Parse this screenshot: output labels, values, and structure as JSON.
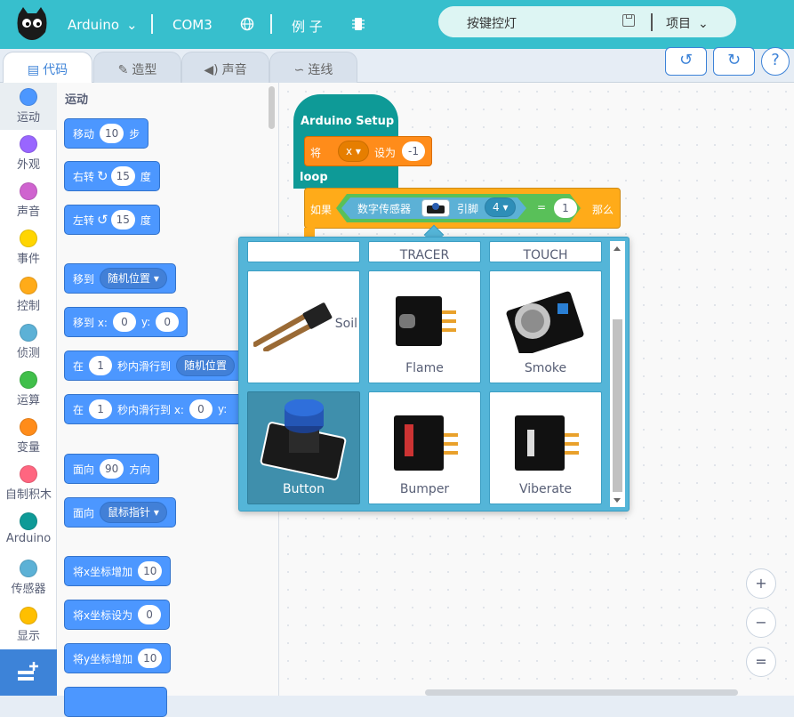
{
  "topbar": {
    "board": "Arduino",
    "port": "COM3",
    "examples": "例 子",
    "project_name": "按键控灯",
    "project_menu": "项目"
  },
  "tabs": [
    {
      "label": "代码",
      "icon": "code-icon",
      "active": true
    },
    {
      "label": "造型",
      "icon": "brush-icon",
      "active": false
    },
    {
      "label": "声音",
      "icon": "speaker-icon",
      "active": false
    },
    {
      "label": "连线",
      "icon": "wiring-icon",
      "active": false
    }
  ],
  "toolbar": {
    "undo": "↺",
    "redo": "↻",
    "help": "?"
  },
  "categories": [
    {
      "label": "运动",
      "color": "#4c97ff"
    },
    {
      "label": "外观",
      "color": "#9966ff"
    },
    {
      "label": "声音",
      "color": "#cf63cf"
    },
    {
      "label": "事件",
      "color": "#ffd500"
    },
    {
      "label": "控制",
      "color": "#ffab19"
    },
    {
      "label": "侦测",
      "color": "#5cb1d6"
    },
    {
      "label": "运算",
      "color": "#40bf4a"
    },
    {
      "label": "变量",
      "color": "#ff8c1a"
    },
    {
      "label": "自制积木",
      "color": "#ff6680"
    },
    {
      "label": "Arduino",
      "color": "#0e9a97"
    },
    {
      "label": "传感器",
      "color": "#5cb1d6"
    },
    {
      "label": "显示",
      "color": "#ffbf00"
    }
  ],
  "palette": {
    "title": "运动",
    "move": {
      "pre": "移动",
      "val": "10",
      "post": "步"
    },
    "turn_right": {
      "pre": "右转",
      "val": "15",
      "post": "度"
    },
    "turn_left": {
      "pre": "左转",
      "val": "15",
      "post": "度"
    },
    "goto": {
      "pre": "移到",
      "menu": "随机位置"
    },
    "goto_xy": {
      "pre": "移到 x:",
      "x": "0",
      "ylbl": "y:",
      "y": "0"
    },
    "glide": {
      "pre": "在",
      "val": "1",
      "mid": "秒内滑行到",
      "menu": "随机位置"
    },
    "glide_xy": {
      "pre": "在",
      "val": "1",
      "mid": "秒内滑行到 x:",
      "x": "0",
      "ylbl": "y:"
    },
    "point_dir": {
      "pre": "面向",
      "val": "90",
      "post": "方向"
    },
    "point_towards": {
      "pre": "面向",
      "menu": "鼠标指针"
    },
    "change_x": {
      "pre": "将x坐标增加",
      "val": "10"
    },
    "set_x": {
      "pre": "将x坐标设为",
      "val": "0"
    },
    "change_y": {
      "pre": "将y坐标增加",
      "val": "10"
    }
  },
  "workspace": {
    "setup_label": "Arduino Setup",
    "set_pre": "将",
    "set_var": "x",
    "set_mid": "设为",
    "set_val": "-1",
    "loop_label": "loop",
    "if_label": "如果",
    "sensor_label": "数字传感器",
    "pin_label": "引脚",
    "pin_val": "4",
    "eq": "=",
    "cmp_val": "1",
    "then_label": "那么"
  },
  "sensor_popup": {
    "top_labels": [
      "",
      "TRACER",
      "TOUCH"
    ],
    "cards": [
      {
        "label": "Soil",
        "selected": false
      },
      {
        "label": "Flame",
        "selected": false
      },
      {
        "label": "Smoke",
        "selected": false
      },
      {
        "label": "Button",
        "selected": true
      },
      {
        "label": "Bumper",
        "selected": false
      },
      {
        "label": "Viberate",
        "selected": false
      }
    ]
  },
  "zoom": {
    "in": "+",
    "out": "−",
    "reset": "="
  }
}
